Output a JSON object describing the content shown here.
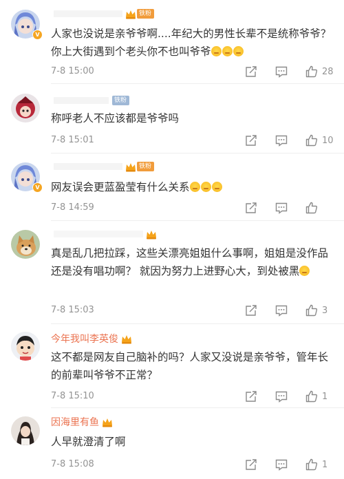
{
  "colors": {
    "name": "#eb7350",
    "text": "#333333",
    "meta": "#939393",
    "divider": "#eeeeee"
  },
  "comments": [
    {
      "username": "",
      "fan_badge": "铁粉",
      "fan_badge_color": "orange",
      "text": "人家也没说是亲爷爷啊....年纪大的男性长辈不是统称爷爷？你上大街遇到个老头你不也叫爷爷",
      "emoji_count": 3,
      "time": "7-8 15:00",
      "likes": "28",
      "avatar_icon": "blue-hair-anime-avatar-icon"
    },
    {
      "username": "",
      "fan_badge": "铁粉",
      "fan_badge_color": "blue",
      "text": "称呼老人不应该都是爷爷吗",
      "emoji_count": 0,
      "time": "7-8 15:01",
      "likes": "10",
      "avatar_icon": "red-character-avatar-icon"
    },
    {
      "username": "",
      "fan_badge": "铁粉",
      "fan_badge_color": "orange",
      "text": "网友误会更蓝盈莹有什么关系",
      "emoji_count": 3,
      "time": "7-8 14:59",
      "likes": "",
      "avatar_icon": "blue-hair-anime-avatar-icon"
    },
    {
      "username": "",
      "fan_badge": "",
      "fan_badge_color": "",
      "text": "真是乱几把拉踩，这些关漂亮姐姐什么事啊，姐姐是没作品还是没有唱功啊？ 就因为努力上进野心大，到处被黑",
      "emoji_count": 1,
      "time": "7-8 15:03",
      "likes": "3",
      "avatar_icon": "shiba-dog-avatar-icon"
    },
    {
      "username": "今年我叫李英俊",
      "fan_badge": "",
      "fan_badge_color": "",
      "text": "这不都是网友自己脑补的吗？人家又没说是亲爷爷，管年长的前辈叫爷爷不正常？",
      "emoji_count": 0,
      "time": "7-8 15:10",
      "likes": "1",
      "avatar_icon": "cartoon-boy-avatar-icon"
    },
    {
      "username": "因海里有鱼",
      "fan_badge": "",
      "fan_badge_color": "",
      "text": "人早就澄清了啊",
      "emoji_count": 0,
      "time": "7-8 15:08",
      "likes": "1",
      "avatar_icon": "girl-photo-avatar-icon"
    }
  ]
}
